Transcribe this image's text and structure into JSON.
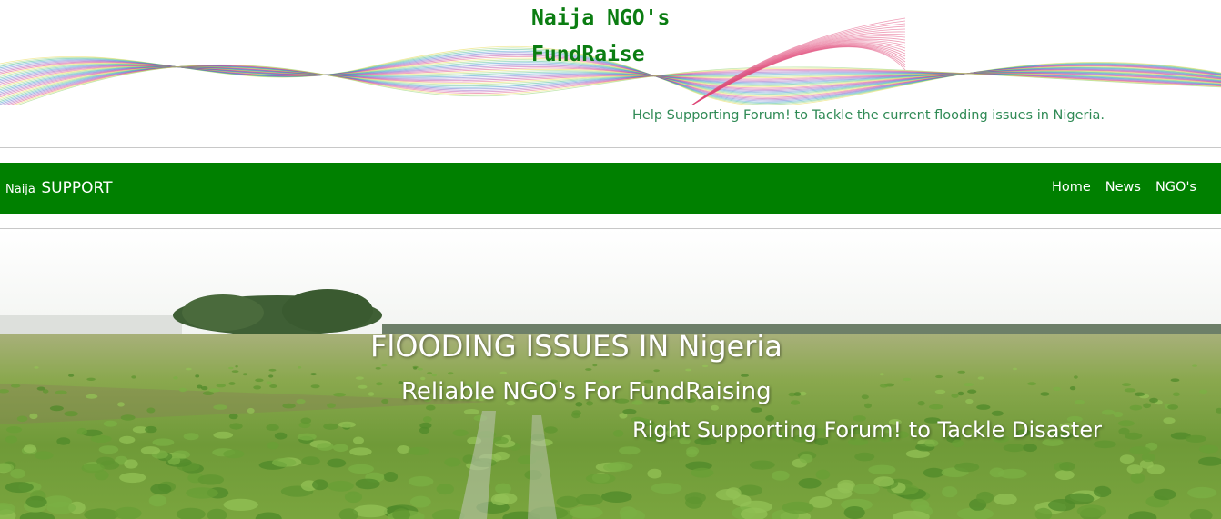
{
  "header": {
    "title_line1": "Naija NGO's",
    "title_line2": "FundRaise",
    "tagline": "Help Supporting Forum! to Tackle the current flooding issues in Nigeria."
  },
  "navbar": {
    "brand_small": "Naija_",
    "brand_big": "SUPPORT",
    "links": [
      "Home",
      "News",
      "NGO's"
    ]
  },
  "hero": {
    "heading": "FlOODING ISSUES IN Nigeria",
    "subheading": "Reliable NGO's For FundRaising",
    "tagline": "Right Supporting Forum! to Tackle Disaster"
  },
  "colors": {
    "navbar_bg": "#008000",
    "title_green": "#0b7d12",
    "tagline_green": "#2f8a55"
  },
  "icons": {
    "banner": "decorative-wave-lines",
    "hero_image": "flooded-maize-field-photo"
  }
}
